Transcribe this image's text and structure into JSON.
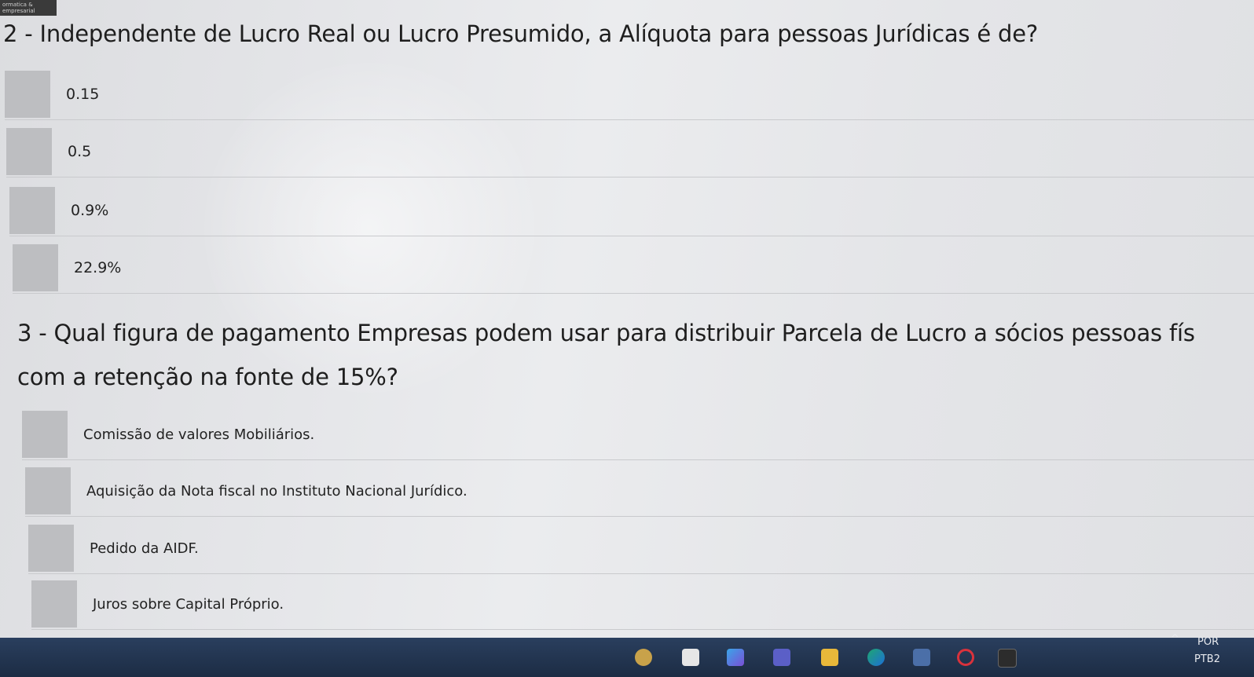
{
  "brand": {
    "line1": "ormatica &",
    "line2": "empresarial"
  },
  "question2": {
    "text": "2 - Independente de Lucro Real ou Lucro Presumido, a Alíquota para pessoas Jurídicas é de?",
    "options": [
      "0.15",
      "0.5",
      "0.9%",
      "22.9%"
    ]
  },
  "question3": {
    "line1": "3 - Qual figura de pagamento Empresas podem usar para distribuir Parcela de Lucro a sócios pessoas fís",
    "line2": "com a retenção na fonte de 15%?",
    "options": [
      "Comissão de valores Mobiliários.",
      "Aquisição da Nota fiscal no Instituto Nacional Jurídico.",
      "Pedido da AIDF.",
      "Juros sobre Capital Próprio."
    ]
  },
  "taskbar": {
    "icons": [
      "weather-icon",
      "widgets-icon",
      "copilot-icon",
      "teams-icon",
      "file-explorer-icon",
      "edge-icon",
      "store-icon",
      "opera-icon",
      "terminal-icon"
    ],
    "tray": {
      "chevron": "^",
      "lang1": "POR",
      "lang2": "PTB2"
    }
  },
  "colors": {
    "background": "#e4e5e8",
    "option_box": "#bdbec1",
    "taskbar": "#1f3049",
    "text": "#1e1e1e"
  }
}
